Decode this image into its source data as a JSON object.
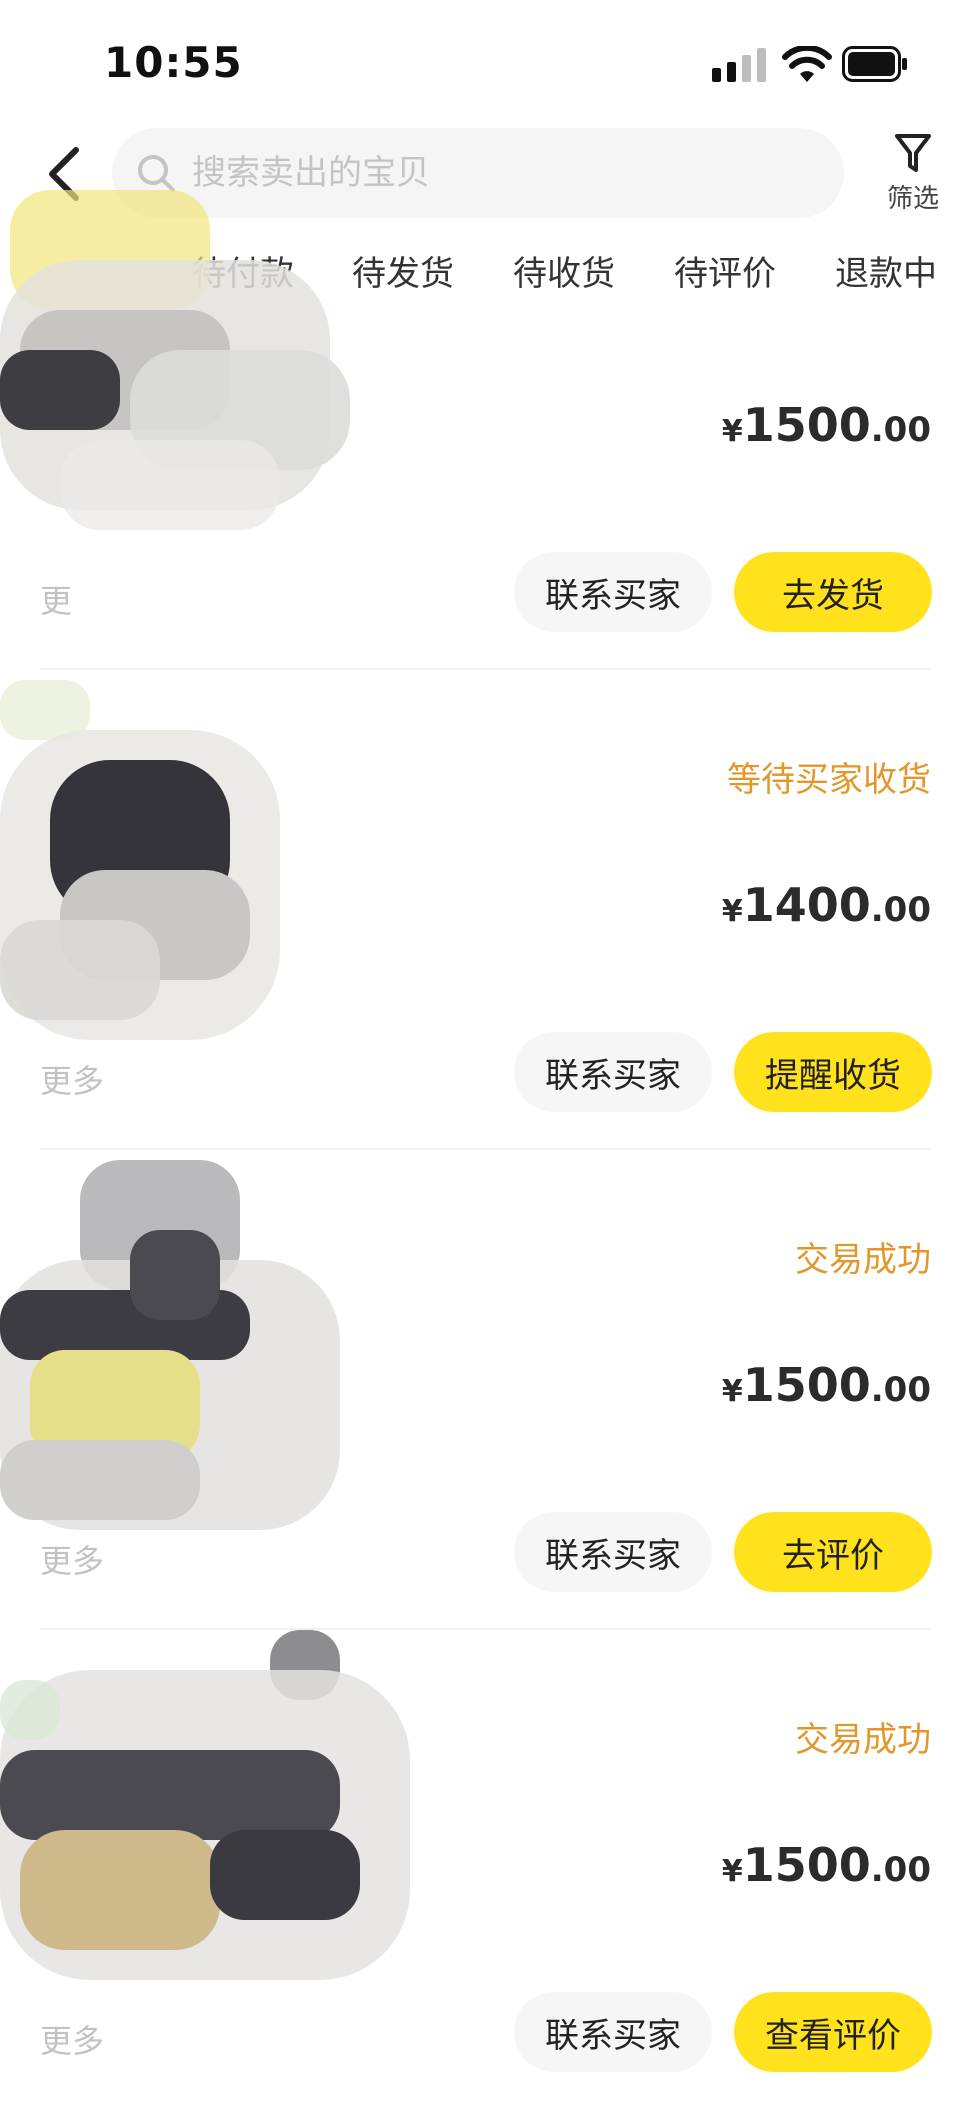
{
  "status_bar": {
    "time": "10:55"
  },
  "search": {
    "placeholder": "搜索卖出的宝贝"
  },
  "filter": {
    "label": "筛选"
  },
  "tabs": [
    "待付款",
    "待发货",
    "待收货",
    "待评价",
    "退款中"
  ],
  "orders": [
    {
      "status": "",
      "currency": "¥",
      "price_int": "1500",
      "price_dec": ".00",
      "more": "更",
      "contact": "联系买家",
      "action": "去发货"
    },
    {
      "status": "等待买家收货",
      "currency": "¥",
      "price_int": "1400",
      "price_dec": ".00",
      "more": "更多",
      "contact": "联系买家",
      "action": "提醒收货"
    },
    {
      "status": "交易成功",
      "currency": "¥",
      "price_int": "1500",
      "price_dec": ".00",
      "more": "更多",
      "contact": "联系买家",
      "action": "去评价"
    },
    {
      "status": "交易成功",
      "currency": "¥",
      "price_int": "1500",
      "price_dec": ".00",
      "more": "更多",
      "contact": "联系买家",
      "action": "查看评价"
    }
  ],
  "colors": {
    "accent_yellow": "#ffe11c",
    "status_orange": "#e3972b"
  }
}
